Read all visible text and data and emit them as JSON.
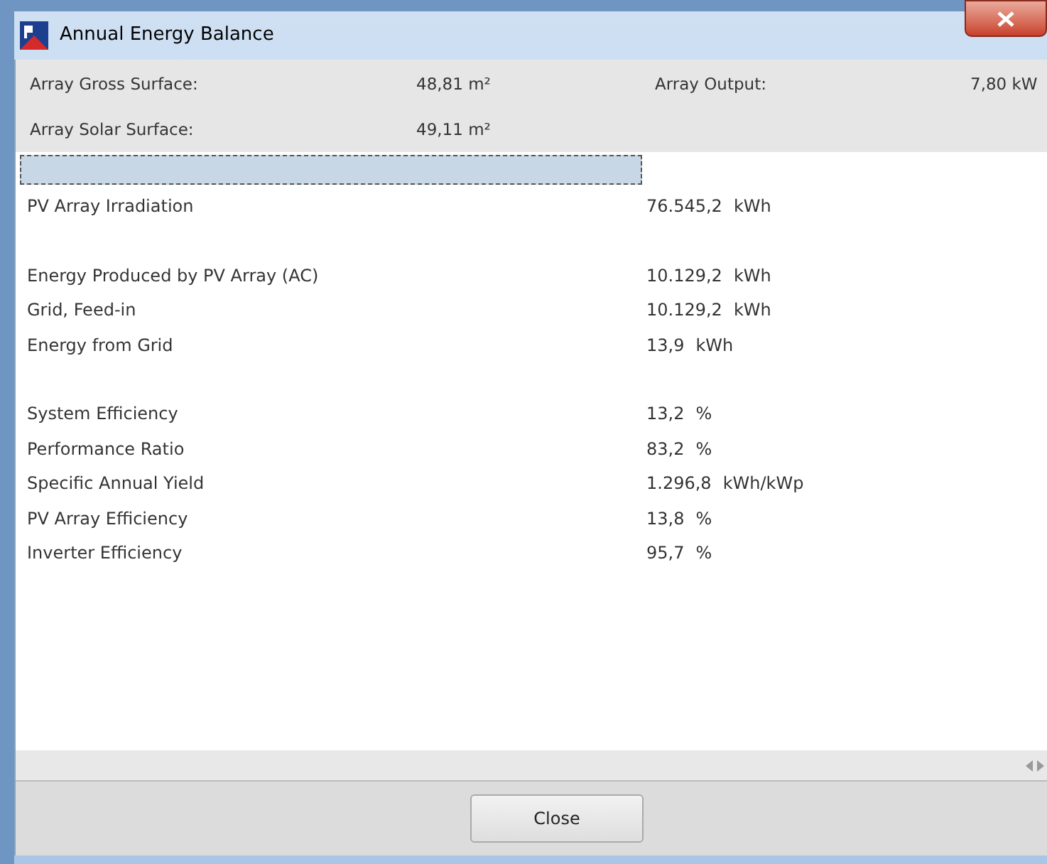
{
  "window": {
    "title": "Annual Energy Balance"
  },
  "header": [
    {
      "label": "Array Gross Surface:",
      "value": "48,81 m²"
    },
    {
      "label": "Array Output:",
      "value": "7,80 kW"
    },
    {
      "label": "Array Solar Surface:",
      "value": "49,11 m²"
    }
  ],
  "groups": [
    {
      "rows": [
        {
          "label": "PV Array Irradiation",
          "value": "76.545,2",
          "unit": "kWh"
        }
      ]
    },
    {
      "rows": [
        {
          "label": "Energy Produced by PV Array (AC)",
          "value": "10.129,2",
          "unit": "kWh"
        },
        {
          "label": "Grid, Feed-in",
          "value": "10.129,2",
          "unit": "kWh"
        },
        {
          "label": "Energy from Grid",
          "value": "13,9",
          "unit": "kWh"
        }
      ]
    },
    {
      "rows": [
        {
          "label": "System Efficiency",
          "value": "13,2",
          "unit": "%"
        },
        {
          "label": "Performance Ratio",
          "value": "83,2",
          "unit": "%"
        },
        {
          "label": "Specific Annual Yield",
          "value": "1.296,8",
          "unit": "kWh/kWp"
        },
        {
          "label": "PV Array Efficiency",
          "value": "13,8",
          "unit": "%"
        },
        {
          "label": "Inverter Efficiency",
          "value": "95,7",
          "unit": "%"
        }
      ]
    }
  ],
  "buttons": [
    {
      "label": "Close"
    }
  ]
}
